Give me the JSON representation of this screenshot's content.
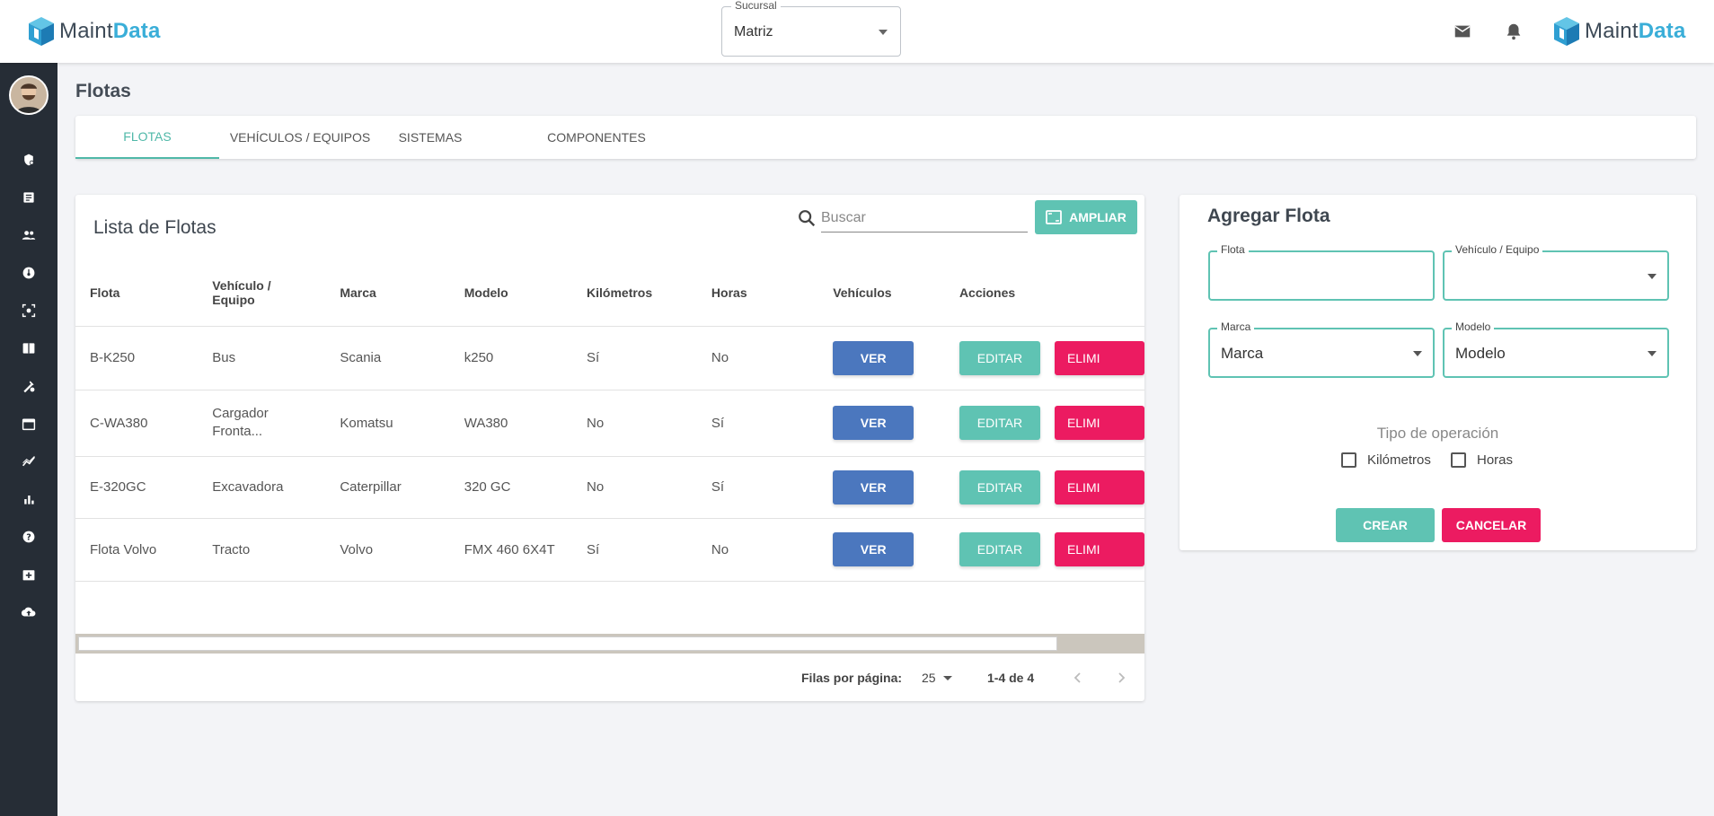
{
  "app": {
    "brand_part1": "Maint",
    "brand_part2": "Data"
  },
  "header": {
    "branch_label": "Sucursal",
    "branch_value": "Matriz"
  },
  "page": {
    "title": "Flotas"
  },
  "tabs": [
    "FLOTAS",
    "VEHÍCULOS / EQUIPOS",
    "SISTEMAS",
    "COMPONENTES"
  ],
  "list": {
    "title": "Lista de Flotas",
    "search_placeholder": "Buscar",
    "expand_label": "AMPLIAR",
    "columns": [
      "Flota",
      "Vehículo / Equipo",
      "Marca",
      "Modelo",
      "Kilómetros",
      "Horas",
      "Vehículos",
      "Acciones"
    ],
    "rows": [
      {
        "flota": "B-K250",
        "vehiculo": "Bus",
        "marca": "Scania",
        "modelo": "k250",
        "km": "Sí",
        "horas": "No"
      },
      {
        "flota": "C-WA380",
        "vehiculo": "Cargador Fronta...",
        "marca": "Komatsu",
        "modelo": "WA380",
        "km": "No",
        "horas": "Sí"
      },
      {
        "flota": "E-320GC",
        "vehiculo": "Excavadora",
        "marca": "Caterpillar",
        "modelo": "320 GC",
        "km": "No",
        "horas": "Sí"
      },
      {
        "flota": "Flota Volvo",
        "vehiculo": "Tracto",
        "marca": "Volvo",
        "modelo": "FMX 460 6X4T",
        "km": "Sí",
        "horas": "No"
      }
    ],
    "view_label": "VER",
    "edit_label": "EDITAR",
    "delete_label": "ELIMI",
    "rows_per_page_label": "Filas por página:",
    "rows_per_page": "25",
    "range": "1-4 de 4"
  },
  "form": {
    "title": "Agregar Flota",
    "flota_label": "Flota",
    "flota_value": "",
    "vehicle_label": "Vehículo / Equipo",
    "vehicle_value": "",
    "marca_label": "Marca",
    "marca_value": "Marca",
    "modelo_label": "Modelo",
    "modelo_value": "Modelo",
    "operation_title": "Tipo de operación",
    "km_label": "Kilómetros",
    "hours_label": "Horas",
    "create_label": "CREAR",
    "cancel_label": "CANCELAR"
  },
  "colors": {
    "primary": "#5fc3b3",
    "blue": "#4b77be",
    "danger": "#ec1b61",
    "sidebar": "#262d36"
  }
}
